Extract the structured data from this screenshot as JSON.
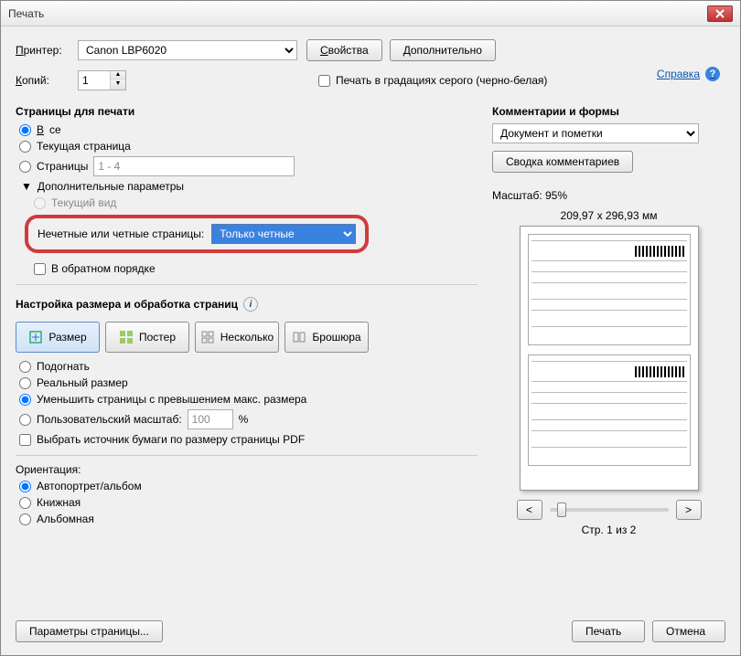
{
  "window": {
    "title": "Печать"
  },
  "help_link": "Справка",
  "printer": {
    "label": "Принтер:",
    "selected": "Canon LBP6020",
    "options": [
      "Canon LBP6020"
    ],
    "properties_btn": "Свойства",
    "advanced_btn": "Дополнительно"
  },
  "copies": {
    "label": "Копий:",
    "value": "1"
  },
  "grayscale": {
    "label": "Печать в градациях серого (черно-белая)",
    "checked": false
  },
  "pages_section": {
    "title": "Страницы для печати",
    "all": "Все",
    "current": "Текущая страница",
    "pages_label": "Страницы",
    "pages_range": "1 - 4",
    "more_params": "Дополнительные параметры",
    "current_view": "Текущий вид",
    "odd_even_label": "Нечетные или четные страницы:",
    "odd_even_selected": "Только четные",
    "odd_even_options": [
      "Только четные"
    ],
    "reverse": "В обратном порядке"
  },
  "sizing_section": {
    "title": "Настройка размера и обработка страниц",
    "size_btn": "Размер",
    "poster_btn": "Постер",
    "multiple_btn": "Несколько",
    "booklet_btn": "Брошюра",
    "fit": "Подогнать",
    "actual": "Реальный размер",
    "shrink": "Уменьшить страницы с превышением макс. размера",
    "custom_scale_label": "Пользовательский масштаб:",
    "custom_scale_value": "100",
    "percent": "%",
    "source_by_pdf": "Выбрать источник бумаги по размеру страницы PDF"
  },
  "orientation": {
    "title": "Ориентация:",
    "auto": "Автопортрет/альбом",
    "portrait": "Книжная",
    "landscape": "Альбомная"
  },
  "comments": {
    "title": "Комментарии и формы",
    "selected": "Документ и пометки",
    "options": [
      "Документ и пометки"
    ],
    "summary_btn": "Сводка комментариев"
  },
  "preview": {
    "scale_label": "Масштаб:  95%",
    "dims": "209,97 x 296,93 мм",
    "page_of": "Стр. 1 из 2",
    "prev": "<",
    "next": ">"
  },
  "footer": {
    "page_setup": "Параметры страницы...",
    "print": "Печать",
    "cancel": "Отмена"
  }
}
